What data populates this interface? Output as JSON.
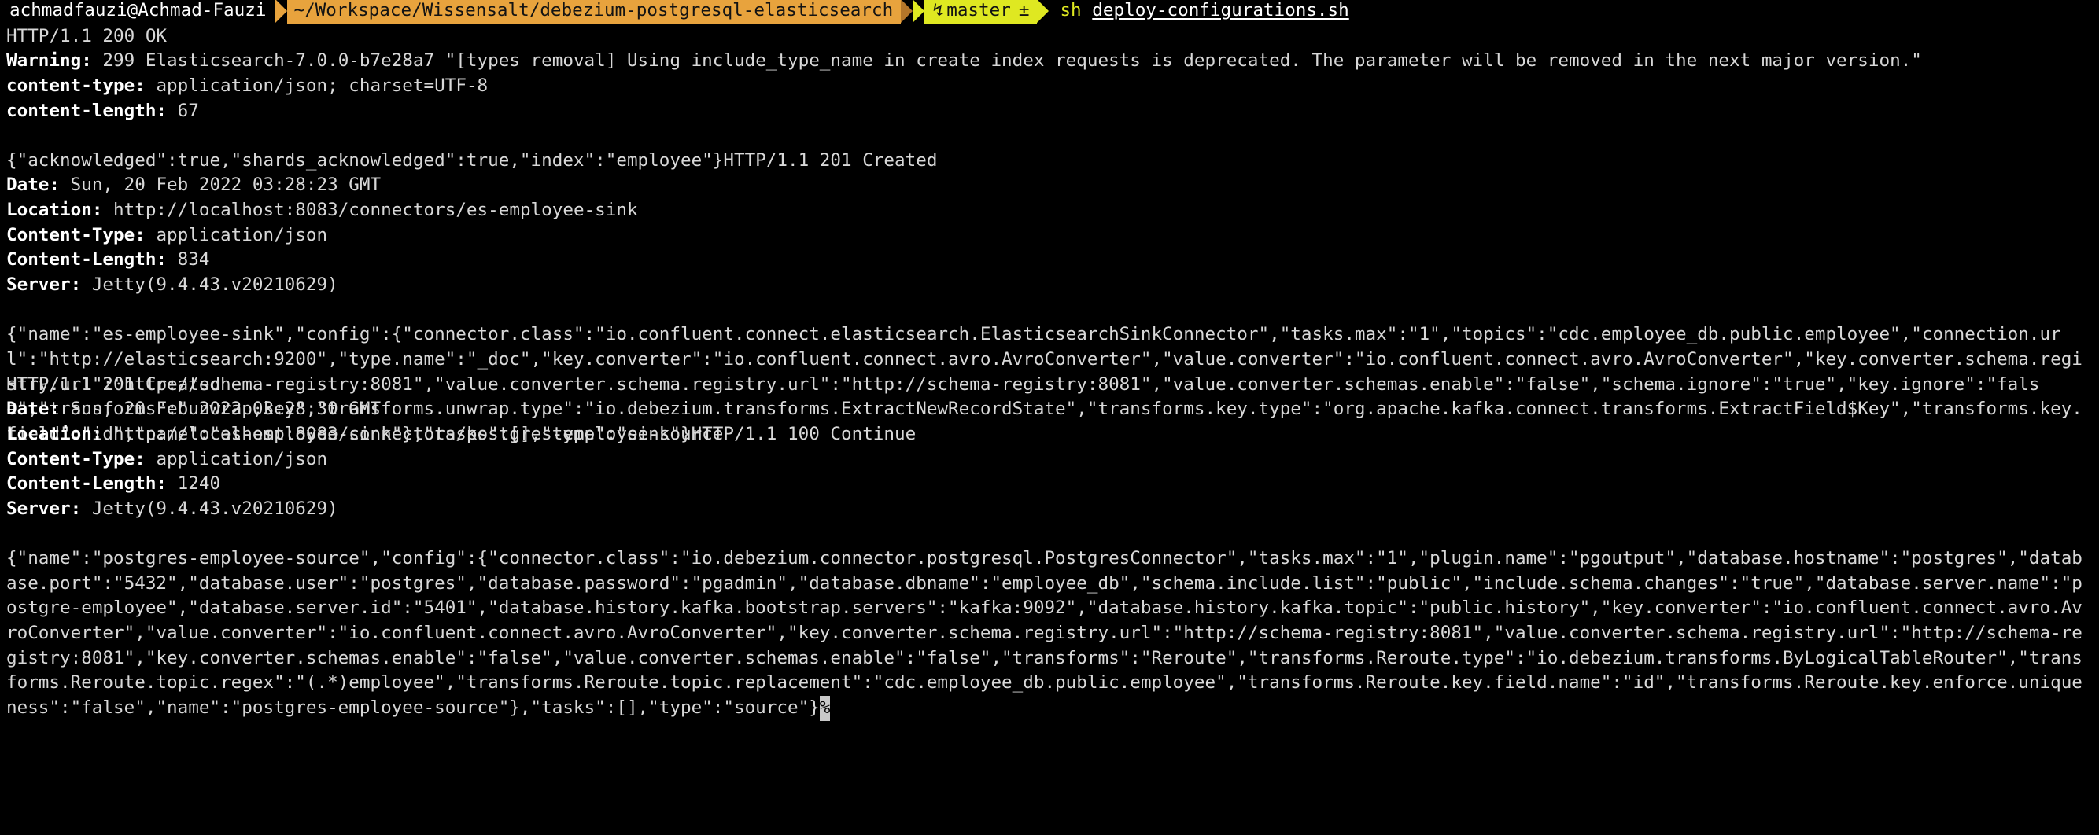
{
  "terminal": {
    "colors": {
      "background": "#000000",
      "foreground": "#d8d8d8",
      "path_segment_bg": "#e8a33d",
      "git_segment_bg": "#dfe821",
      "command_fg": "#dfe821",
      "header_fg": "#ffffff",
      "cursor_bg": "#c8c8c8"
    },
    "prompt": {
      "user_host": "achmadfauzi@Achmad-Fauzi",
      "path": "~/Workspace/Wissensalt/debezium-postgresql-elasticsearch",
      "git_icon": "git-branch-icon",
      "git_branch": "master",
      "git_dirty_marker": "±",
      "command": "sh",
      "command_arg": "deploy-configurations.sh"
    },
    "cursor_glyph": "%"
  },
  "output": {
    "lines": [
      {
        "type": "plain",
        "text": "HTTP/1.1 200 OK"
      },
      {
        "type": "header",
        "name": "Warning",
        "value": "299 Elasticsearch-7.0.0-b7e28a7 \"[types removal] Using include_type_name in create index requests is deprecated. The parameter will be removed in the next major version.\""
      },
      {
        "type": "header",
        "name": "content-type",
        "value": "application/json; charset=UTF-8"
      },
      {
        "type": "header",
        "name": "content-length",
        "value": "67"
      },
      {
        "type": "blank"
      },
      {
        "type": "plain",
        "text": "{\"acknowledged\":true,\"shards_acknowledged\":true,\"index\":\"employee\"}HTTP/1.1 201 Created"
      },
      {
        "type": "header",
        "name": "Date",
        "value": "Sun, 20 Feb 2022 03:28:23 GMT"
      },
      {
        "type": "header",
        "name": "Location",
        "value": "http://localhost:8083/connectors/es-employee-sink"
      },
      {
        "type": "header",
        "name": "Content-Type",
        "value": "application/json"
      },
      {
        "type": "header",
        "name": "Content-Length",
        "value": "834"
      },
      {
        "type": "header",
        "name": "Server",
        "value": "Jetty(9.4.43.v20210629)"
      },
      {
        "type": "blank"
      },
      {
        "type": "plain",
        "text": "{\"name\":\"es-employee-sink\",\"config\":{\"connector.class\":\"io.confluent.connect.elasticsearch.ElasticsearchSinkConnector\",\"tasks.max\":\"1\",\"topics\":\"cdc.employee_db.public.employee\",\"connection.url\":\"http://elasticsearch:9200\",\"type.name\":\"_doc\",\"key.converter\":\"io.confluent.connect.avro.AvroConverter\",\"value.converter\":\"io.confluent.connect.avro.AvroConverter\",\"key.converter.schema.registry.url\":\"http://schema-registry:8081\",\"value.converter.schema.registry.url\":\"http://schema-registry:8081\",\"value.converter.schemas.enable\":\"false\",\"schema.ignore\":\"true\",\"key.ignore\":\"false\",\"transforms\":\"unwrap,key\",\"transforms.unwrap.type\":\"io.debezium.transforms.ExtractNewRecordState\",\"transforms.key.type\":\"org.apache.kafka.connect.transforms.ExtractField$Key\",\"transforms.key.field\":\"id\",\"name\":\"es-employee-sink\"},\"tasks\":[],\"type\":\"sink\"}HTTP/1.1 100 Continue"
      },
      {
        "type": "blank"
      },
      {
        "type": "plain",
        "text": "HTTP/1.1 201 Created"
      },
      {
        "type": "header",
        "name": "Date",
        "value": "Sun, 20 Feb 2022 03:28:30 GMT"
      },
      {
        "type": "header",
        "name": "Location",
        "value": "http://localhost:8083/connectors/postgres-employee-source"
      },
      {
        "type": "header",
        "name": "Content-Type",
        "value": "application/json"
      },
      {
        "type": "header",
        "name": "Content-Length",
        "value": "1240"
      },
      {
        "type": "header",
        "name": "Server",
        "value": "Jetty(9.4.43.v20210629)"
      },
      {
        "type": "blank"
      },
      {
        "type": "json_tail",
        "text": "{\"name\":\"postgres-employee-source\",\"config\":{\"connector.class\":\"io.debezium.connector.postgresql.PostgresConnector\",\"tasks.max\":\"1\",\"plugin.name\":\"pgoutput\",\"database.hostname\":\"postgres\",\"database.port\":\"5432\",\"database.user\":\"postgres\",\"database.password\":\"pgadmin\",\"database.dbname\":\"employee_db\",\"schema.include.list\":\"public\",\"include.schema.changes\":\"true\",\"database.server.name\":\"postgre-employee\",\"database.server.id\":\"5401\",\"database.history.kafka.bootstrap.servers\":\"kafka:9092\",\"database.history.kafka.topic\":\"public.history\",\"key.converter\":\"io.confluent.connect.avro.AvroConverter\",\"value.converter\":\"io.confluent.connect.avro.AvroConverter\",\"key.converter.schema.registry.url\":\"http://schema-registry:8081\",\"value.converter.schema.registry.url\":\"http://schema-registry:8081\",\"key.converter.schemas.enable\":\"false\",\"value.converter.schemas.enable\":\"false\",\"transforms\":\"Reroute\",\"transforms.Reroute.type\":\"io.debezium.transforms.ByLogicalTableRouter\",\"transforms.Reroute.topic.regex\":\"(.*)employee\",\"transforms.Reroute.topic.replacement\":\"cdc.employee_db.public.employee\",\"transforms.Reroute.key.field.name\":\"id\",\"transforms.Reroute.key.enforce.uniqueness\":\"false\",\"name\":\"postgres-employee-source\"},\"tasks\":[],\"type\":\"source\"}"
      }
    ]
  }
}
